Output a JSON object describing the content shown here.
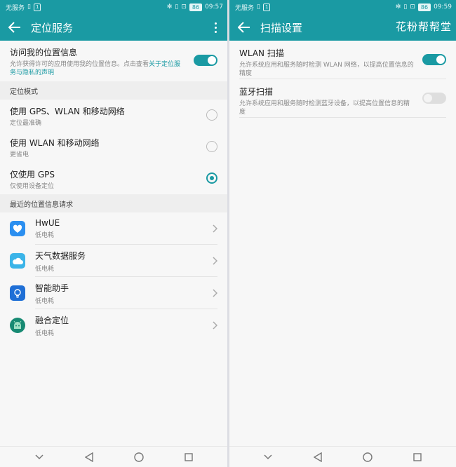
{
  "left": {
    "status": {
      "carrier": "无服务",
      "badge": "1",
      "time": "09:57",
      "battery": "86"
    },
    "title": "定位服务",
    "access": {
      "title": "访问我的位置信息",
      "desc": "允许获得许可的应用使用我的位置信息。点击查看",
      "link": "关于定位服务与隐私的声明",
      "enabled": true
    },
    "mode_header": "定位模式",
    "modes": [
      {
        "title": "使用 GPS、WLAN 和移动网络",
        "sub": "定位最准确",
        "selected": false
      },
      {
        "title": "使用 WLAN 和移动网络",
        "sub": "更省电",
        "selected": false
      },
      {
        "title": "仅使用 GPS",
        "sub": "仅使用设备定位",
        "selected": true
      }
    ],
    "recent_header": "最近的位置信息请求",
    "apps": [
      {
        "name": "HwUE",
        "sub": "低电耗",
        "icon": "hwue-heart-icon",
        "color": "#2b8ff0"
      },
      {
        "name": "天气数据服务",
        "sub": "低电耗",
        "icon": "weather-cloud-icon",
        "color": "#3bb4e8"
      },
      {
        "name": "智能助手",
        "sub": "低电耗",
        "icon": "smart-assistant-bulb-icon",
        "color": "#1f6fd6"
      },
      {
        "name": "融合定位",
        "sub": "低电耗",
        "icon": "android-robot-icon",
        "color": "#178a73"
      }
    ]
  },
  "right": {
    "status": {
      "carrier": "无服务",
      "badge": "1",
      "time": "09:59",
      "battery": "86"
    },
    "title": "扫描设置",
    "watermark": "花粉帮帮堂",
    "items": [
      {
        "title": "WLAN 扫描",
        "desc": "允许系统应用和服务随时检测 WLAN 网络，以提高位置信息的精度",
        "enabled": true
      },
      {
        "title": "蓝牙扫描",
        "desc": "允许系统应用和服务随时检测蓝牙设备，以提高位置信息的精度",
        "enabled": false
      }
    ]
  },
  "colors": {
    "accent": "#1a9aa3"
  }
}
